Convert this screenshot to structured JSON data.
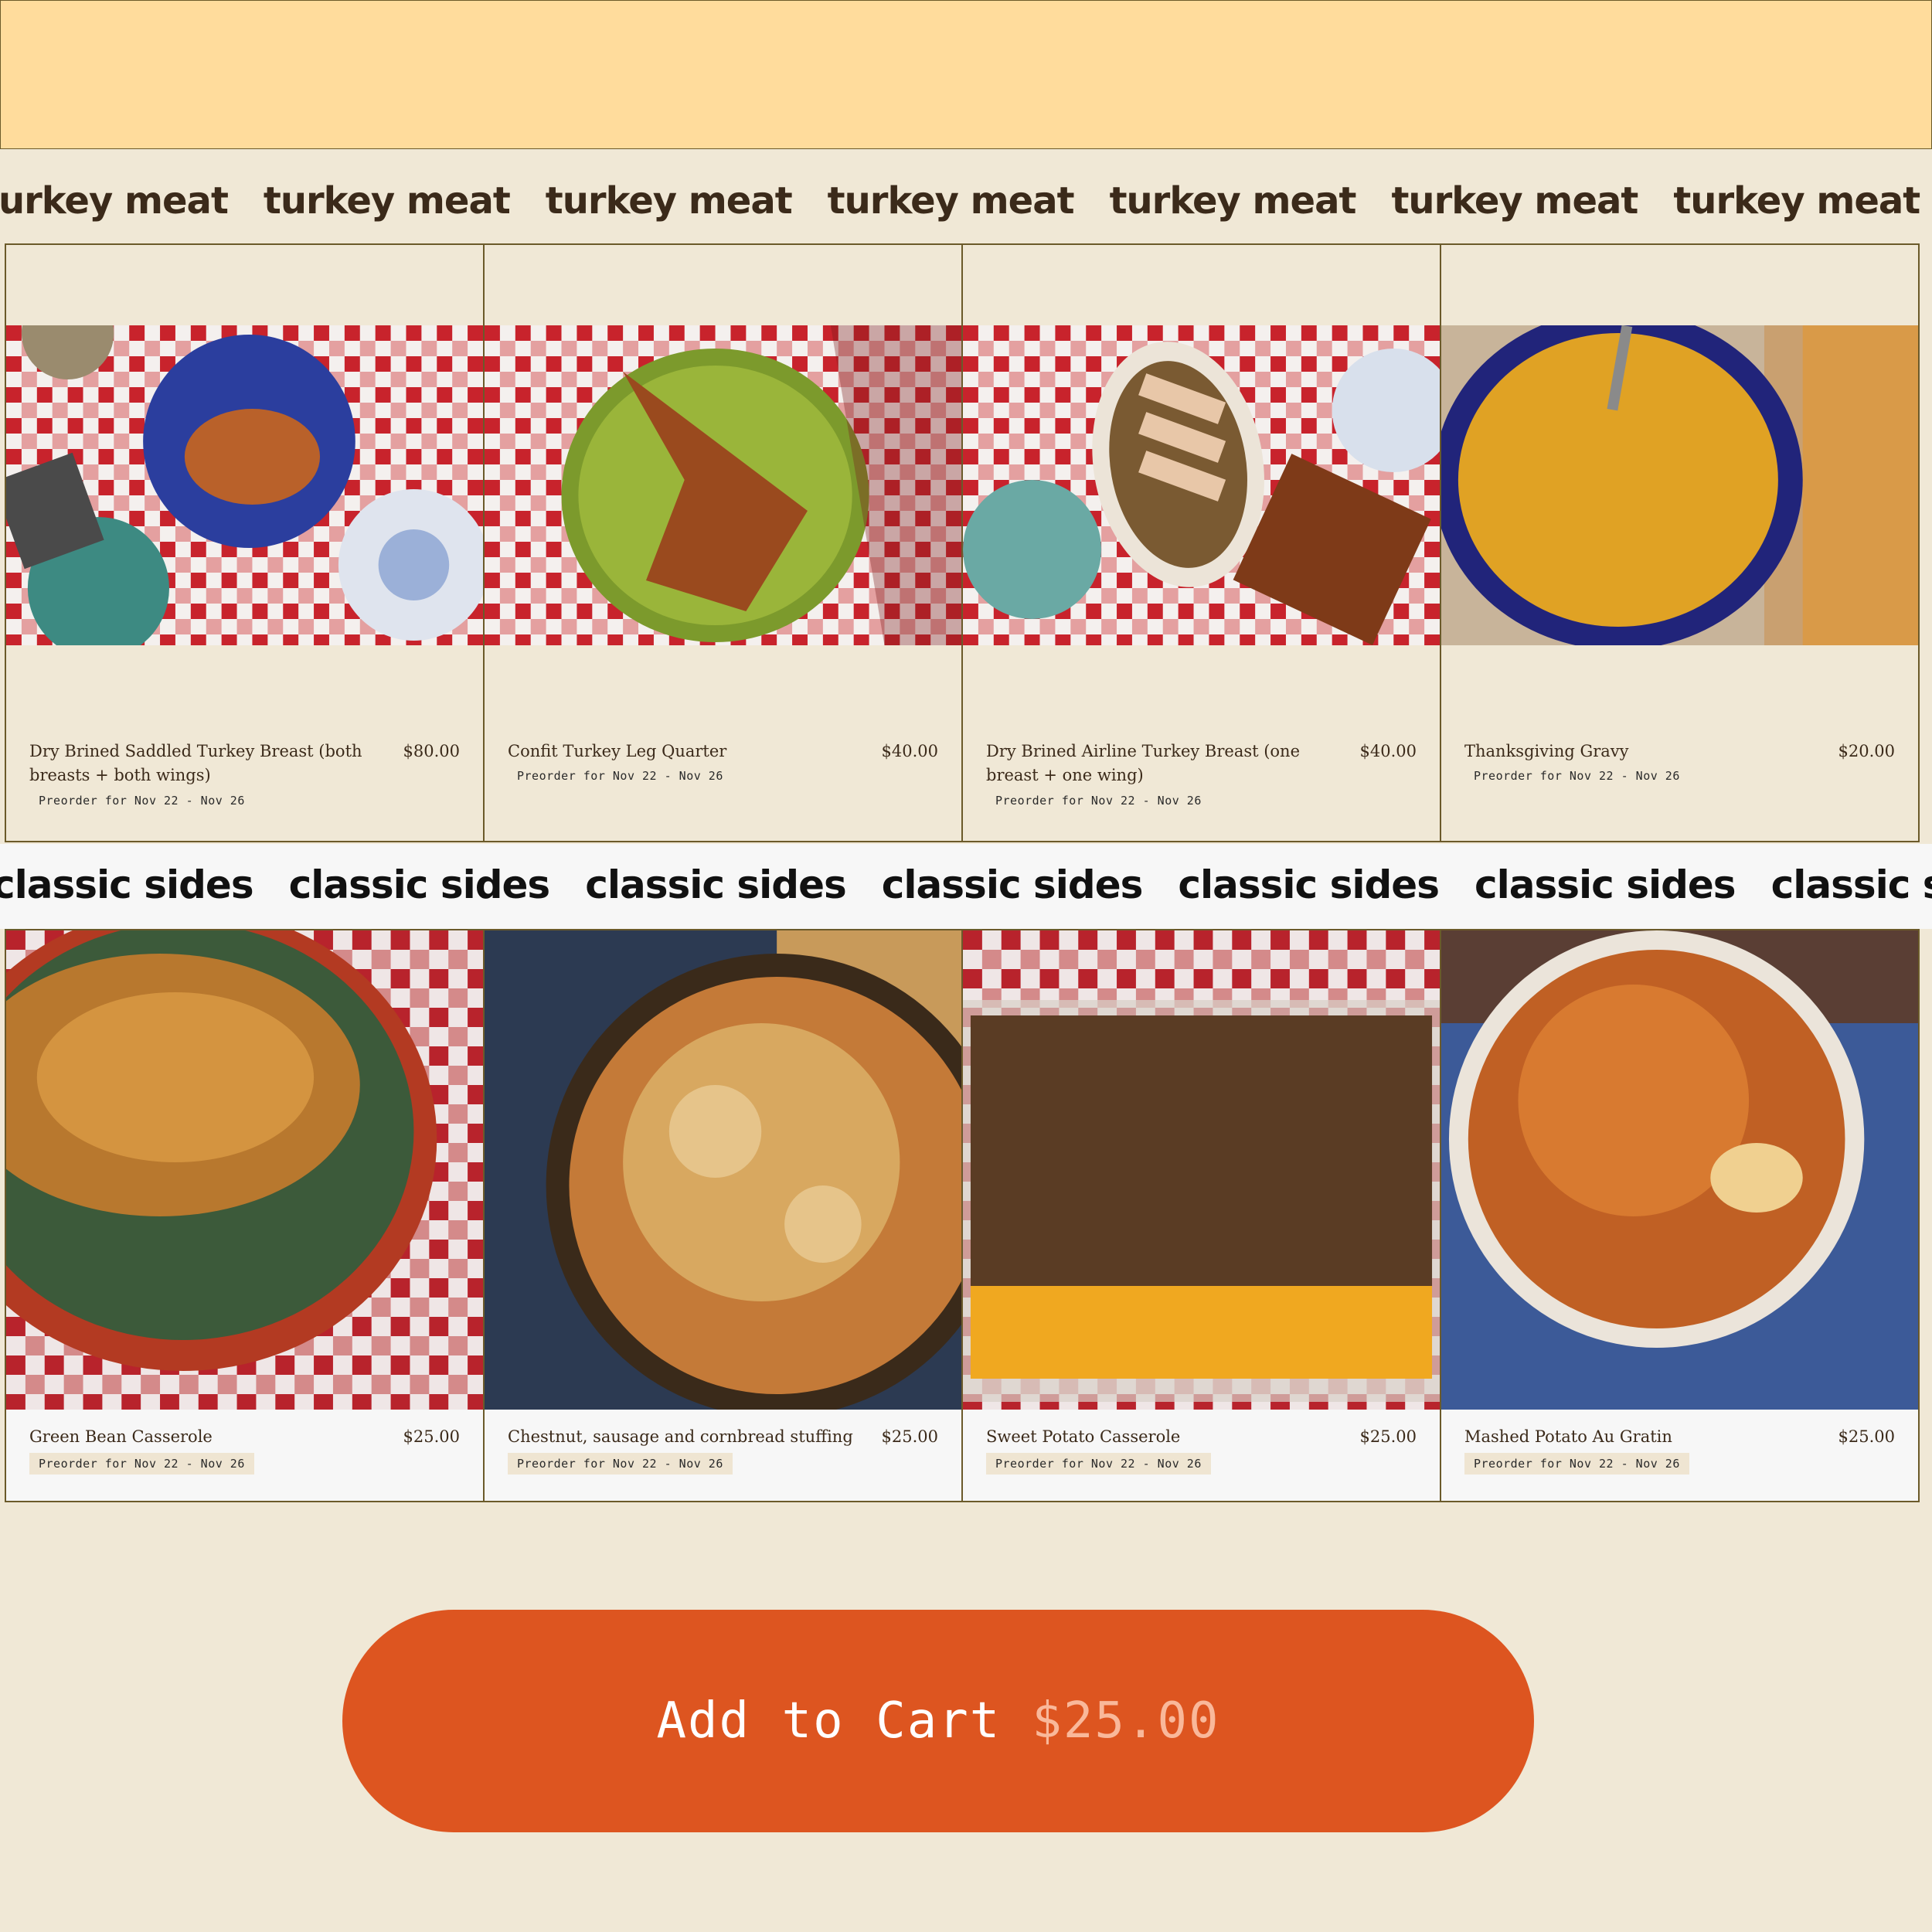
{
  "sections": {
    "meat": {
      "marquee_text": "turkey meat"
    },
    "sides": {
      "marquee_text": "classic sides"
    }
  },
  "meat_items": [
    {
      "name": "Dry Brined Saddled Turkey Breast (both breasts + both wings)",
      "price": "$80.00",
      "badge": "Preorder for Nov 22 - Nov 26"
    },
    {
      "name": "Confit Turkey Leg Quarter",
      "price": "$40.00",
      "badge": "Preorder for Nov 22 - Nov 26"
    },
    {
      "name": "Dry Brined Airline Turkey Breast (one breast + one wing)",
      "price": "$40.00",
      "badge": "Preorder for Nov 22 - Nov 26"
    },
    {
      "name": "Thanksgiving Gravy",
      "price": "$20.00",
      "badge": "Preorder for Nov 22 - Nov 26"
    }
  ],
  "side_items": [
    {
      "name": "Green Bean Casserole",
      "price": "$25.00",
      "badge": "Preorder for Nov 22 - Nov 26"
    },
    {
      "name": "Chestnut, sausage and cornbread stuffing",
      "price": "$25.00",
      "badge": "Preorder for Nov 22 - Nov 26"
    },
    {
      "name": "Sweet Potato Casserole",
      "price": "$25.00",
      "badge": "Preorder for Nov 22 - Nov 26"
    },
    {
      "name": "Mashed Potato Au Gratin",
      "price": "$25.00",
      "badge": "Preorder for Nov 22 - Nov 26"
    }
  ],
  "cart": {
    "label": "Add to Cart",
    "amount": "$25.00"
  },
  "colors": {
    "banner": "#ffdc9c",
    "page_bg": "#f0e8d6",
    "button": "#dd5520",
    "button_amount": "#f9b89a",
    "marquee_meat": "#3b2a1a"
  }
}
